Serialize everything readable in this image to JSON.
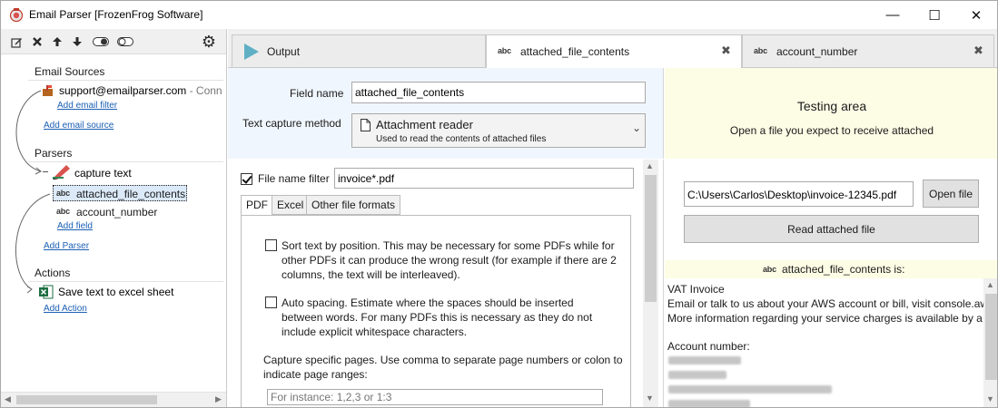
{
  "window": {
    "title": "Email Parser [FrozenFrog Software]",
    "controls": {
      "minimize": "—",
      "maximize": "☐",
      "close": "✕"
    }
  },
  "toolbar": {
    "icons": [
      "edit-icon",
      "delete-icon",
      "move-up-icon",
      "move-down-icon",
      "toggle-on-icon",
      "toggle-off-icon",
      "settings-gear-icon"
    ]
  },
  "sidebar": {
    "email_sources_header": "Email Sources",
    "source_name": "support@emailparser.com",
    "source_status": " - Conn",
    "add_email_filter": "Add email filter",
    "add_email_source": "Add email source",
    "parsers_header": "Parsers",
    "parser_name": "capture text",
    "field_selected": "attached_file_contents",
    "field_other": "account_number",
    "abc": "abc",
    "add_field": "Add field",
    "add_parser": "Add Parser",
    "actions_header": "Actions",
    "action_name": "Save text to excel sheet",
    "add_action": "Add Action"
  },
  "tabs": {
    "output": "Output",
    "attached": "attached_file_contents",
    "account": "account_number",
    "close": "✖",
    "abc": "abc"
  },
  "field_form": {
    "field_name_label": "Field name",
    "field_name_value": "attached_file_contents",
    "capture_method_label": "Text capture method",
    "capture_method_title": "Attachment reader",
    "capture_method_desc": "Used to read the contents of attached files",
    "chevron": "⌄"
  },
  "settings": {
    "file_filter_label": "File name filter",
    "file_filter_value": "invoice*.pdf",
    "subtabs": [
      "PDF",
      "Excel",
      "Other file formats"
    ],
    "sort_text": "Sort text by position. This may be necessary for some PDFs while for other PDFs it can produce the wrong result (for example if there are 2 columns, the text will be interleaved).",
    "auto_spacing": "Auto spacing. Estimate where the spaces should be inserted between words. For many PDFs this is necessary as they do not include explicit whitespace characters.",
    "capture_pages": "Capture specific pages. Use comma to separate page numbers or colon to indicate page ranges:",
    "pages_placeholder": "For instance: 1,2,3 or 1:3"
  },
  "testing": {
    "title": "Testing area",
    "subtitle": "Open a file you expect to receive attached",
    "file_path": "C:\\Users\\Carlos\\Desktop\\invoice-12345.pdf",
    "open_file": "Open file",
    "read_file": "Read attached file",
    "result_label": "attached_file_contents is:",
    "abc": "abc",
    "line1": "VAT Invoice",
    "line2": "Email or talk to us about your AWS account or bill, visit console.aw",
    "line3": "More information regarding your service charges is available by a",
    "line4": "Account number:"
  }
}
